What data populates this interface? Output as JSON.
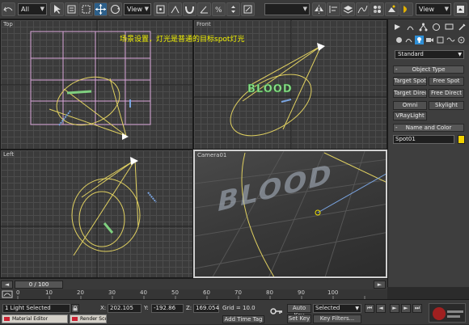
{
  "toolbar": {
    "selection_filter": "All",
    "ref_coord": "View",
    "ref_coord2": "View",
    "colors": {
      "active_icon": "#2f8fd6"
    }
  },
  "viewports": {
    "top": {
      "label": "Top"
    },
    "front": {
      "label": "Front"
    },
    "left": {
      "label": "Left"
    },
    "camera": {
      "label": "Camera01"
    },
    "annotation": "场景设置，灯光是普通的目标spot灯光",
    "blood_text": "BLOOD"
  },
  "command_panel": {
    "category": "Standard",
    "object_type_header": "Object Type",
    "buttons": [
      "Target Spot",
      "Free Spot",
      "Target Direct",
      "Free Direct",
      "Omni",
      "Skylight",
      "VRayLight"
    ],
    "name_color_header": "Name and Color",
    "object_name": "Spot01",
    "object_color": "#f2d200"
  },
  "timeline": {
    "frame_display": "0 / 100",
    "ticks": [
      "0",
      "10",
      "20",
      "30",
      "40",
      "50",
      "60",
      "70",
      "80",
      "90",
      "100"
    ]
  },
  "status": {
    "selection": "1 Light Selected",
    "x_label": "X:",
    "x_value": "202.105",
    "y_label": "Y:",
    "y_value": "-192.86",
    "z_label": "Z:",
    "z_value": "169.054",
    "grid": "Grid = 10.0",
    "add_time_tag": "Add Time Tag",
    "auto_key": "Auto Key",
    "auto_key_mode": "Selected",
    "set_key": "Set Key",
    "key_filters": "Key Filters...",
    "taskbar": [
      "Material Editor",
      "Render Scene"
    ]
  }
}
